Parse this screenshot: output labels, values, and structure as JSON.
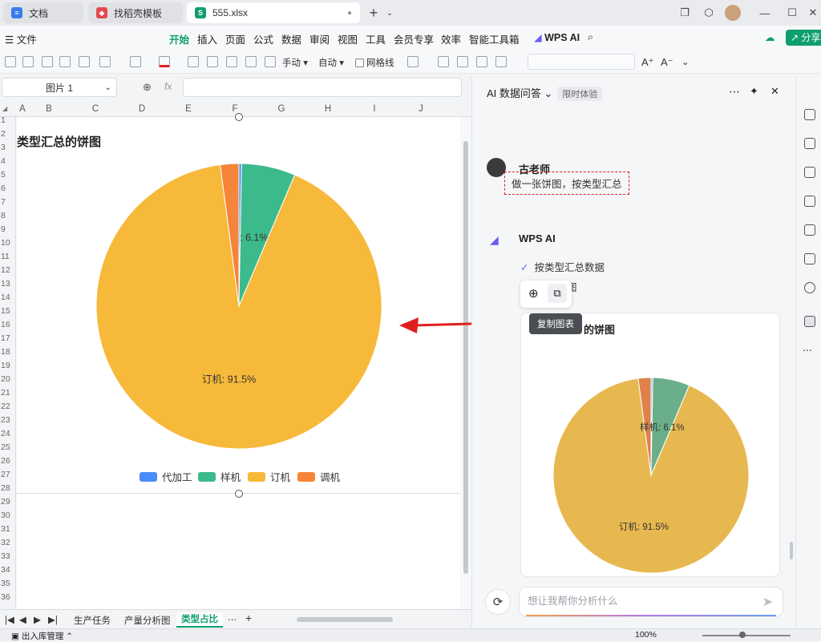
{
  "tabs": [
    {
      "label": "文档",
      "color": "#3a7cf0",
      "glyph": "≡"
    },
    {
      "label": "找稻壳模板",
      "color": "#e5484d",
      "glyph": "◆"
    },
    {
      "label": "555.xlsx",
      "color": "#0e9f6e",
      "glyph": "S"
    }
  ],
  "menu": {
    "file": "文件",
    "items": [
      "开始",
      "插入",
      "页面",
      "公式",
      "数据",
      "审阅",
      "视图",
      "工具",
      "会员专享",
      "效率",
      "智能工具箱"
    ],
    "wps_ai": "WPS AI",
    "share": "分享"
  },
  "toolbar": {
    "manual": "手动",
    "auto": "自动",
    "gridlines": "网格线"
  },
  "formula": {
    "namebox": "图片 1",
    "fx": "fx"
  },
  "columns": [
    "A",
    "B",
    "C",
    "D",
    "E",
    "F",
    "G",
    "H",
    "I",
    "J"
  ],
  "rows": [
    "1",
    "2",
    "3",
    "4",
    "5",
    "6",
    "7",
    "8",
    "9",
    "10",
    "11",
    "12",
    "13",
    "14",
    "15",
    "16",
    "17",
    "18",
    "19",
    "20",
    "21",
    "22",
    "23",
    "24",
    "25",
    "26",
    "27",
    "28",
    "29",
    "30",
    "31",
    "32",
    "33",
    "34",
    "35",
    "36"
  ],
  "chart_data": {
    "type": "pie",
    "title": "类型汇总的饼图",
    "categories": [
      "代加工",
      "样机",
      "订机",
      "调机"
    ],
    "values": [
      0.3,
      6.1,
      91.5,
      2.1
    ],
    "colors": [
      "#4a8cf7",
      "#3dba8c",
      "#f7b93a",
      "#f5853a"
    ],
    "data_labels": [
      "",
      "样机: 6.1%",
      "订机: 91.5%",
      ""
    ],
    "legend": "bottom"
  },
  "sheet_tabs": [
    "生产任务",
    "产量分析图",
    "类型占比"
  ],
  "status": {
    "left": "出入库管理",
    "zoom": "100%"
  },
  "ai_panel": {
    "title": "AI 数据问答",
    "badge": "限时体验",
    "user_name": "古老师",
    "user_message": "做一张饼图，按类型汇总",
    "ai_name": "WPS AI",
    "step1": "按类型汇总数据",
    "step2": "图",
    "tooltip": "复制图表",
    "card_title": "的饼图",
    "card_labels": [
      "样机: 6.1%",
      "订机: 91.5%"
    ],
    "card_colors": [
      "#8ab4f8",
      "#6aaf8a",
      "#e8b850",
      "#e0804a"
    ],
    "input_placeholder": "想让我帮你分析什么"
  }
}
